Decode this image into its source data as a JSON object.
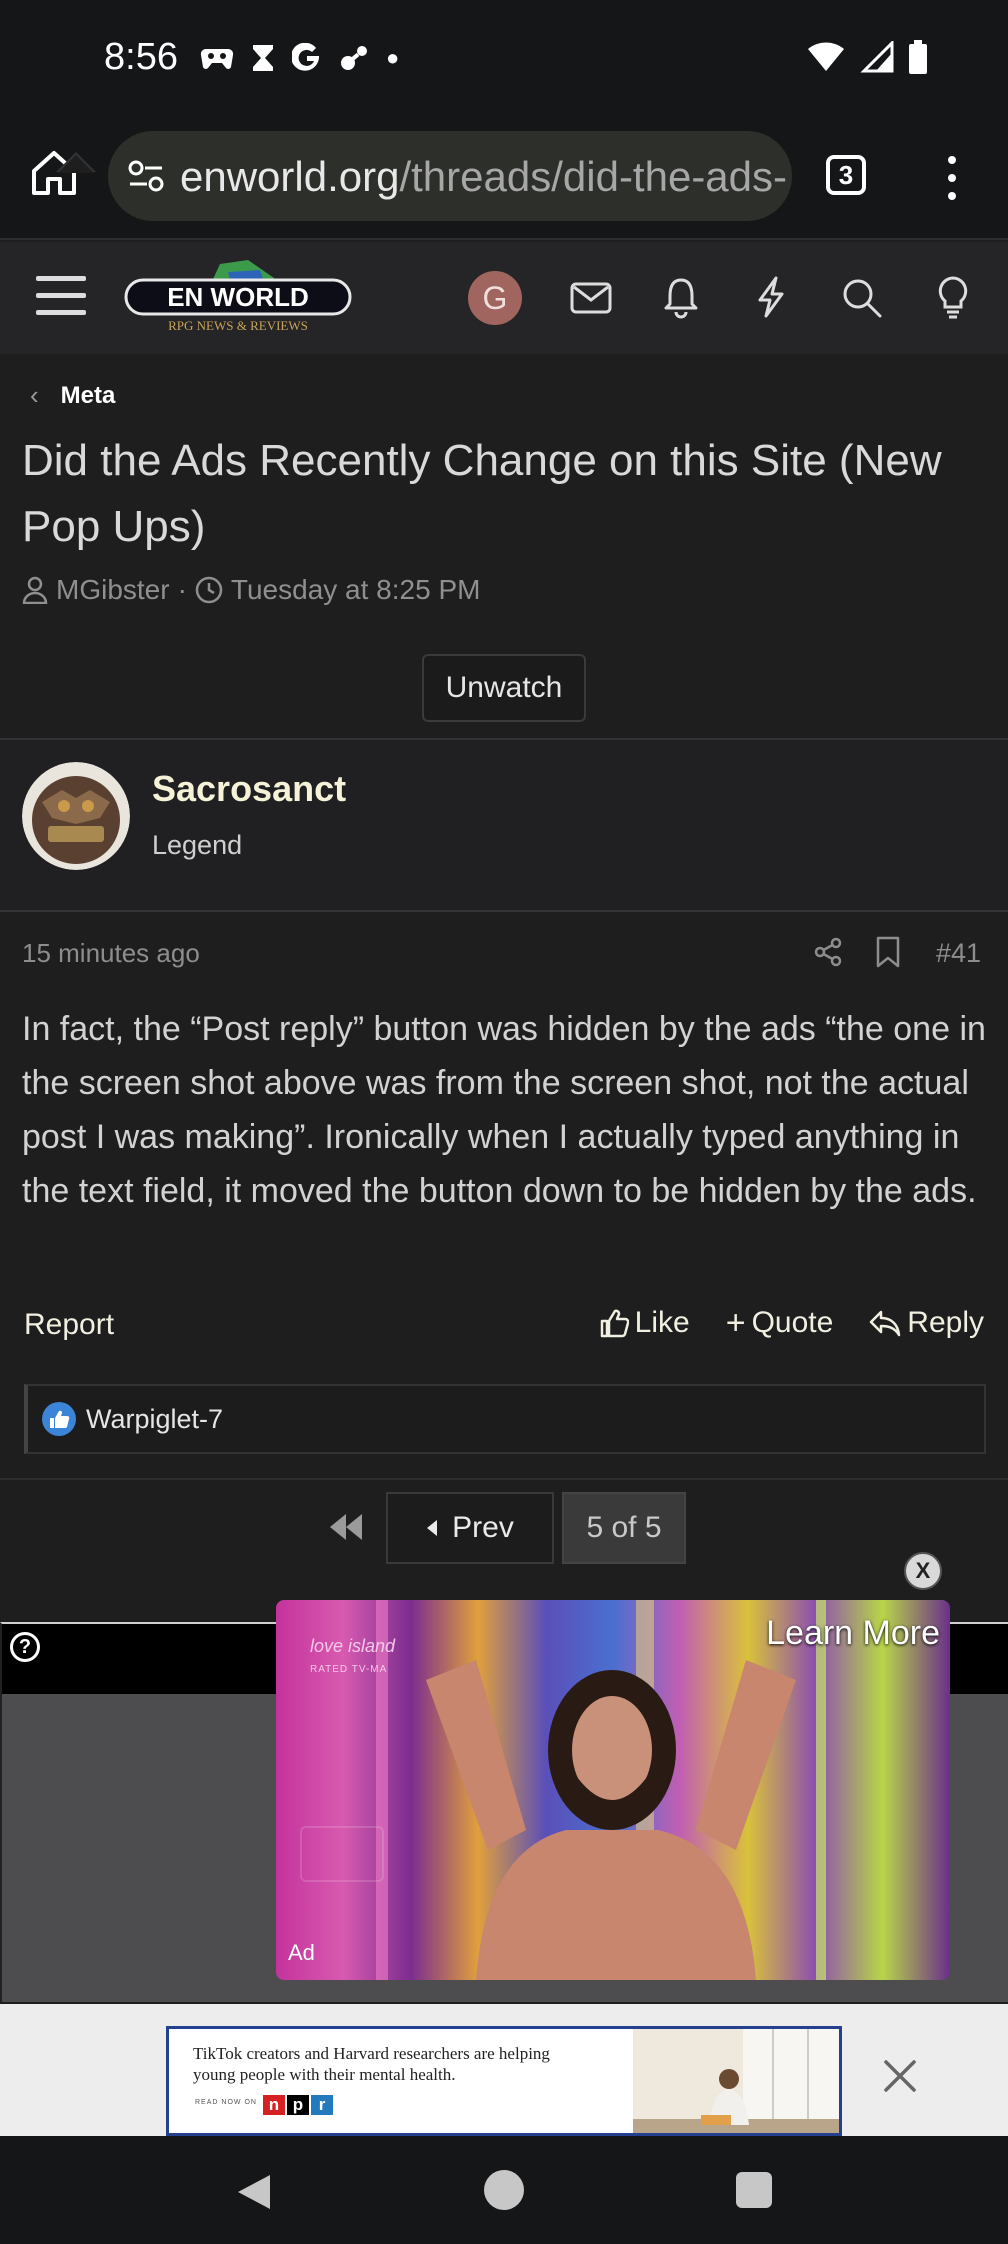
{
  "status_bar": {
    "time": "8:56"
  },
  "browser": {
    "url_host": "enworld.org",
    "url_path": "/threads/did-the-ads-",
    "tab_count": "3"
  },
  "site_header": {
    "logo_text": "EN WORLD",
    "logo_subtext": "RPG NEWS & REVIEWS",
    "account_initial": "G"
  },
  "breadcrumb": {
    "label": "Meta"
  },
  "thread": {
    "title": "Did the Ads Recently Change on this Site (New Pop Ups)",
    "author": "MGibster",
    "separator": "·",
    "date": "Tuesday at 8:25 PM",
    "unwatch_label": "Unwatch"
  },
  "post": {
    "username": "Sacrosanct",
    "user_title": "Legend",
    "time": "15 minutes ago",
    "number": "#41",
    "body": "In fact, the “Post reply” button was hidden by the ads “the one in the screen shot above was from the screen shot, not the actual post I was making”. Ironically when I actually typed anything in the text field, it moved the button down to be hidden by the ads.",
    "report_label": "Report",
    "like_label": "Like",
    "quote_label": "Quote",
    "reply_label": "Reply",
    "reaction_user": "Warpiglet-7"
  },
  "pagination": {
    "prev_label": "Prev",
    "current": "5 of 5"
  },
  "video_ad": {
    "learn_more": "Learn More",
    "ad_label": "Ad",
    "brand": "love island",
    "rating": "RATED TV-MA",
    "close": "X",
    "help": "?"
  },
  "banner_ad": {
    "text": "TikTok creators and Harvard researchers are helping young people with their mental health.",
    "read_now": "READ NOW ON",
    "npr_letters": [
      "n",
      "p",
      "r"
    ],
    "npr_colors": [
      "#d62021",
      "#000000",
      "#237bbd"
    ]
  },
  "colors": {
    "accent_username": "#f5f2d8",
    "like_blue": "#3b84d8",
    "avatar_g": "#a1655f"
  }
}
